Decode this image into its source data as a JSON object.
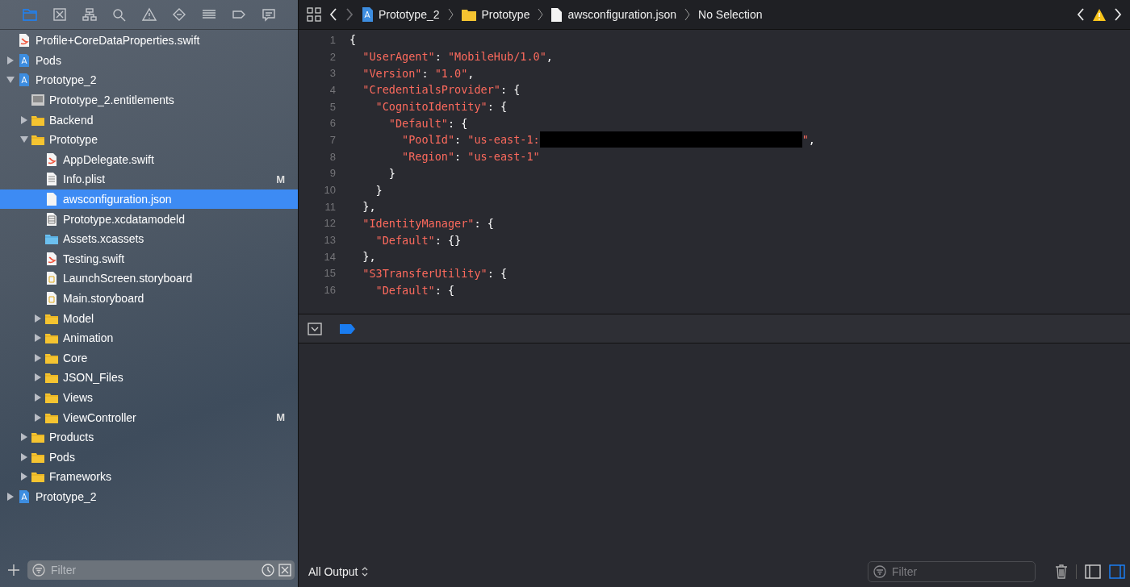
{
  "navigator_tabs": [
    {
      "kind": "folder",
      "selected": true
    },
    {
      "kind": "xsquare",
      "selected": false
    },
    {
      "kind": "hierarchy",
      "selected": false
    },
    {
      "kind": "search",
      "selected": false
    },
    {
      "kind": "warning",
      "selected": false
    },
    {
      "kind": "diamond",
      "selected": false
    },
    {
      "kind": "list",
      "selected": false
    },
    {
      "kind": "tag",
      "selected": false
    },
    {
      "kind": "speech",
      "selected": false
    }
  ],
  "tree": [
    {
      "name": "Profile+CoreDataProperties.swift",
      "kind": "swift",
      "selected": false
    },
    {
      "name": "Pods",
      "kind": "project",
      "expanded": false,
      "selected": false
    },
    {
      "name": "Prototype_2",
      "kind": "project",
      "expanded": true,
      "selected": false,
      "children": [
        {
          "name": "Prototype_2.entitlements",
          "kind": "entitlements",
          "selected": false
        },
        {
          "name": "Backend",
          "kind": "folder",
          "expanded": false,
          "selected": false
        },
        {
          "name": "Prototype",
          "kind": "folder",
          "expanded": true,
          "selected": false,
          "children": [
            {
              "name": "AppDelegate.swift",
              "kind": "swift",
              "selected": false
            },
            {
              "name": "Info.plist",
              "kind": "plist",
              "badge": "M",
              "selected": false
            },
            {
              "name": "awsconfiguration.json",
              "kind": "file",
              "selected": true
            },
            {
              "name": "Prototype.xcdatamodeld",
              "kind": "datamodel",
              "selected": false
            },
            {
              "name": "Assets.xcassets",
              "kind": "assets",
              "selected": false
            },
            {
              "name": "Testing.swift",
              "kind": "swift",
              "selected": false
            },
            {
              "name": "LaunchScreen.storyboard",
              "kind": "storyboard",
              "selected": false
            },
            {
              "name": "Main.storyboard",
              "kind": "storyboard",
              "selected": false
            },
            {
              "name": "Model",
              "kind": "folder",
              "expanded": false,
              "selected": false
            },
            {
              "name": "Animation",
              "kind": "folder",
              "expanded": false,
              "selected": false
            },
            {
              "name": "Core",
              "kind": "folder",
              "expanded": false,
              "selected": false
            },
            {
              "name": "JSON_Files",
              "kind": "folder",
              "expanded": false,
              "selected": false
            },
            {
              "name": "Views",
              "kind": "folder",
              "expanded": false,
              "selected": false
            },
            {
              "name": "ViewController",
              "kind": "folder",
              "expanded": false,
              "badge": "M",
              "selected": false
            }
          ]
        },
        {
          "name": "Products",
          "kind": "folder",
          "expanded": false,
          "selected": false
        },
        {
          "name": "Pods",
          "kind": "folder",
          "expanded": false,
          "selected": false
        },
        {
          "name": "Frameworks",
          "kind": "folder",
          "expanded": false,
          "selected": false
        }
      ]
    },
    {
      "name": "Prototype_2",
      "kind": "project",
      "expanded": false,
      "selected": false
    }
  ],
  "sidebar_filter": {
    "placeholder": "Filter"
  },
  "breadcrumbs": [
    {
      "label": "Prototype_2",
      "kind": "project"
    },
    {
      "label": "Prototype",
      "kind": "folder"
    },
    {
      "label": "awsconfiguration.json",
      "kind": "file"
    },
    {
      "label": "No Selection",
      "kind": "none"
    }
  ],
  "code_lines": [
    {
      "number": "1",
      "segments": [
        {
          "kind": "punct",
          "text": "{"
        }
      ]
    },
    {
      "number": "2",
      "segments": [
        {
          "kind": "string",
          "text": "\"UserAgent\""
        },
        {
          "kind": "punct",
          "text": ": "
        },
        {
          "kind": "string",
          "text": "\"MobileHub/1.0\""
        },
        {
          "kind": "punct",
          "text": ","
        }
      ]
    },
    {
      "number": "3",
      "segments": [
        {
          "kind": "string",
          "text": "\"Version\""
        },
        {
          "kind": "punct",
          "text": ": "
        },
        {
          "kind": "string",
          "text": "\"1.0\""
        },
        {
          "kind": "punct",
          "text": ","
        }
      ]
    },
    {
      "number": "4",
      "segments": [
        {
          "kind": "string",
          "text": "\"CredentialsProvider\""
        },
        {
          "kind": "punct",
          "text": ": {"
        }
      ]
    },
    {
      "number": "5",
      "segments": [
        {
          "kind": "string",
          "text": "\"CognitoIdentity\""
        },
        {
          "kind": "punct",
          "text": ": {"
        }
      ]
    },
    {
      "number": "6",
      "segments": [
        {
          "kind": "string",
          "text": "\"Default\""
        },
        {
          "kind": "punct",
          "text": ": {"
        }
      ]
    },
    {
      "number": "7",
      "segments": [
        {
          "kind": "string",
          "text": "\"PoolId\""
        },
        {
          "kind": "punct",
          "text": ": "
        },
        {
          "kind": "string",
          "text": "\"us-east-1:"
        },
        {
          "kind": "redacted"
        },
        {
          "kind": "string",
          "text": "\""
        },
        {
          "kind": "punct",
          "text": ","
        }
      ]
    },
    {
      "number": "8",
      "segments": [
        {
          "kind": "string",
          "text": "\"Region\""
        },
        {
          "kind": "punct",
          "text": ": "
        },
        {
          "kind": "string",
          "text": "\"us-east-1\""
        }
      ]
    },
    {
      "number": "9",
      "segments": [
        {
          "kind": "punct",
          "text": "}"
        }
      ]
    },
    {
      "number": "10",
      "segments": [
        {
          "kind": "punct",
          "text": "}"
        }
      ]
    },
    {
      "number": "11",
      "segments": [
        {
          "kind": "punct",
          "text": "},"
        }
      ]
    },
    {
      "number": "12",
      "segments": [
        {
          "kind": "string",
          "text": "\"IdentityManager\""
        },
        {
          "kind": "punct",
          "text": ": {"
        }
      ]
    },
    {
      "number": "13",
      "segments": [
        {
          "kind": "string",
          "text": "\"Default\""
        },
        {
          "kind": "punct",
          "text": ": {}"
        }
      ]
    },
    {
      "number": "14",
      "segments": [
        {
          "kind": "punct",
          "text": "},"
        }
      ]
    },
    {
      "number": "15",
      "segments": [
        {
          "kind": "string",
          "text": "\"S3TransferUtility\""
        },
        {
          "kind": "punct",
          "text": ": {"
        }
      ]
    },
    {
      "number": "16",
      "segments": [
        {
          "kind": "string",
          "text": "\"Default\""
        },
        {
          "kind": "punct",
          "text": ": {"
        }
      ]
    }
  ],
  "output": {
    "selector": "All Output",
    "filter_placeholder": "Filter",
    "panes": [
      {
        "selected": false
      },
      {
        "selected": true
      }
    ]
  }
}
